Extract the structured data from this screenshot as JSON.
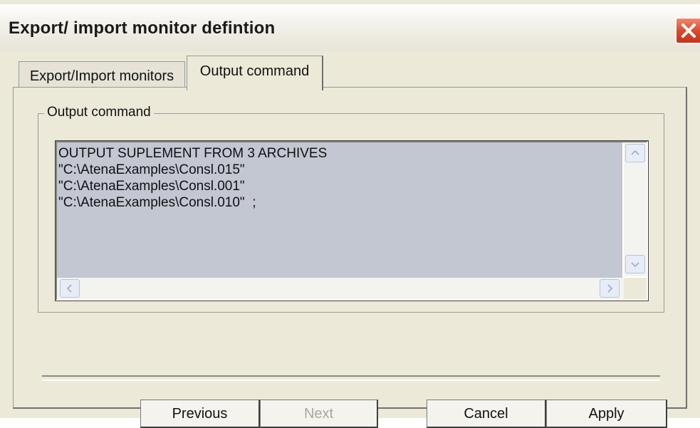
{
  "window": {
    "title": "Export/ import monitor defintion",
    "close_icon": "close-icon",
    "accent_close": "#d8472a"
  },
  "tabs": [
    {
      "label": "Export/Import monitors",
      "active": false
    },
    {
      "label": "Output command",
      "active": true
    }
  ],
  "group": {
    "label": "Output command",
    "lines": [
      "OUTPUT SUPLEMENT FROM 3 ARCHIVES",
      "\"C:\\AtenaExamples\\Consl.015\"",
      "\"C:\\AtenaExamples\\Consl.001\"",
      "\"C:\\AtenaExamples\\Consl.010\"  ;"
    ],
    "scroll_icons": {
      "up": "scroll-up-icon",
      "down": "scroll-down-icon",
      "left": "scroll-left-icon",
      "right": "scroll-right-icon"
    }
  },
  "buttons": {
    "previous": "Previous",
    "next": "Next",
    "cancel": "Cancel",
    "apply": "Apply"
  }
}
